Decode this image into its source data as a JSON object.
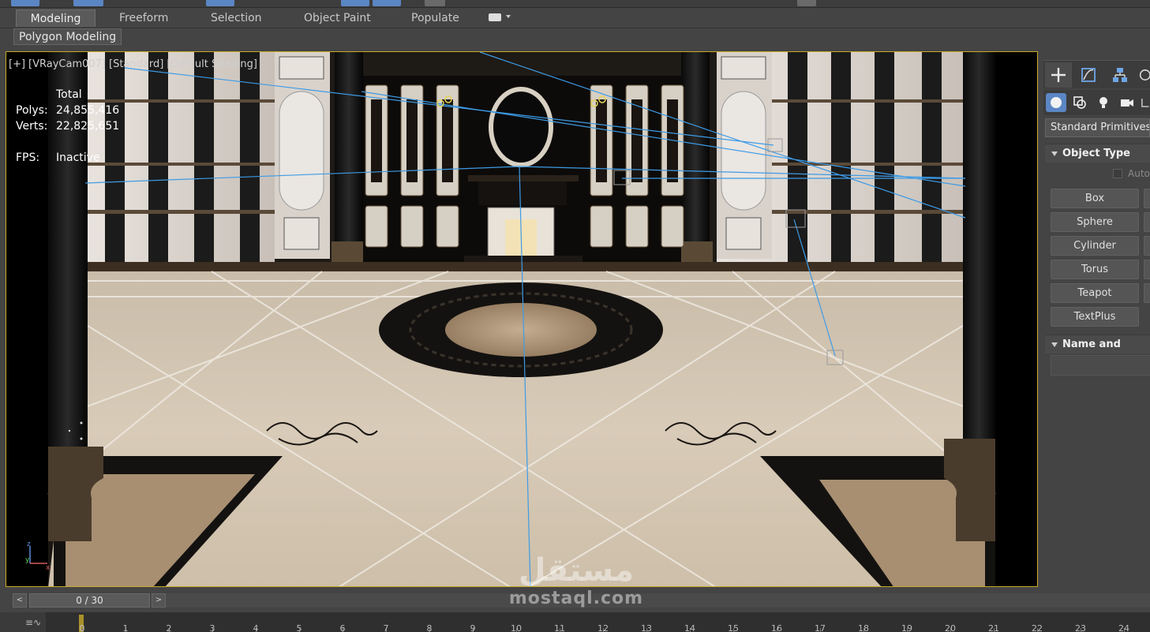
{
  "ribbon": {
    "tabs": [
      {
        "label": "Modeling",
        "active": true
      },
      {
        "label": "Freeform",
        "active": false
      },
      {
        "label": "Selection",
        "active": false
      },
      {
        "label": "Object Paint",
        "active": false
      },
      {
        "label": "Populate",
        "active": false
      }
    ],
    "sub_label": "Polygon Modeling"
  },
  "viewport": {
    "labels": [
      "[+]",
      "[VRayCam007]",
      "[Standard]",
      "[Default Shading]"
    ],
    "stats": {
      "header": "Total",
      "polys_label": "Polys:",
      "polys_value": "24,855,416",
      "verts_label": "Verts:",
      "verts_value": "22,825,651",
      "fps_label": "FPS:",
      "fps_value": "Inactive"
    },
    "border_color": "#c8a92a"
  },
  "command_panel": {
    "tabs": [
      "create-icon",
      "modify-icon",
      "hierarchy-icon",
      "motion-icon"
    ],
    "categories": [
      "geometry-icon",
      "shapes-icon",
      "lights-icon",
      "cameras-icon",
      "helpers-icon"
    ],
    "dropdown_value": "Standard Primitives",
    "object_type_title": "Object Type",
    "autogrid_label": "AutoGrid",
    "primitives": [
      "Box",
      "Sphere",
      "Cylinder",
      "Torus",
      "Teapot",
      "TextPlus"
    ],
    "name_color_title": "Name and Color"
  },
  "time_slider": {
    "position": "0 / 30",
    "prev": "<",
    "next": ">"
  },
  "track_bar": {
    "frame_labels": [
      "0",
      "1",
      "2",
      "3",
      "4",
      "5",
      "6",
      "7",
      "8",
      "9",
      "10",
      "11",
      "12",
      "13",
      "14",
      "15",
      "16",
      "17",
      "18",
      "19",
      "20",
      "21",
      "22",
      "23",
      "24"
    ]
  },
  "watermark": {
    "logo_text": "مستقل",
    "url": "mostaql.com"
  }
}
